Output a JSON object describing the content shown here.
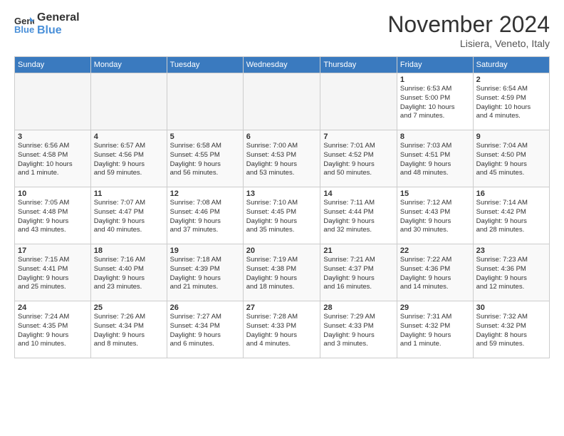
{
  "logo": {
    "line1": "General",
    "line2": "Blue"
  },
  "title": "November 2024",
  "subtitle": "Lisiera, Veneto, Italy",
  "weekdays": [
    "Sunday",
    "Monday",
    "Tuesday",
    "Wednesday",
    "Thursday",
    "Friday",
    "Saturday"
  ],
  "weeks": [
    [
      {
        "day": "",
        "info": ""
      },
      {
        "day": "",
        "info": ""
      },
      {
        "day": "",
        "info": ""
      },
      {
        "day": "",
        "info": ""
      },
      {
        "day": "",
        "info": ""
      },
      {
        "day": "1",
        "info": "Sunrise: 6:53 AM\nSunset: 5:00 PM\nDaylight: 10 hours\nand 7 minutes."
      },
      {
        "day": "2",
        "info": "Sunrise: 6:54 AM\nSunset: 4:59 PM\nDaylight: 10 hours\nand 4 minutes."
      }
    ],
    [
      {
        "day": "3",
        "info": "Sunrise: 6:56 AM\nSunset: 4:58 PM\nDaylight: 10 hours\nand 1 minute."
      },
      {
        "day": "4",
        "info": "Sunrise: 6:57 AM\nSunset: 4:56 PM\nDaylight: 9 hours\nand 59 minutes."
      },
      {
        "day": "5",
        "info": "Sunrise: 6:58 AM\nSunset: 4:55 PM\nDaylight: 9 hours\nand 56 minutes."
      },
      {
        "day": "6",
        "info": "Sunrise: 7:00 AM\nSunset: 4:53 PM\nDaylight: 9 hours\nand 53 minutes."
      },
      {
        "day": "7",
        "info": "Sunrise: 7:01 AM\nSunset: 4:52 PM\nDaylight: 9 hours\nand 50 minutes."
      },
      {
        "day": "8",
        "info": "Sunrise: 7:03 AM\nSunset: 4:51 PM\nDaylight: 9 hours\nand 48 minutes."
      },
      {
        "day": "9",
        "info": "Sunrise: 7:04 AM\nSunset: 4:50 PM\nDaylight: 9 hours\nand 45 minutes."
      }
    ],
    [
      {
        "day": "10",
        "info": "Sunrise: 7:05 AM\nSunset: 4:48 PM\nDaylight: 9 hours\nand 43 minutes."
      },
      {
        "day": "11",
        "info": "Sunrise: 7:07 AM\nSunset: 4:47 PM\nDaylight: 9 hours\nand 40 minutes."
      },
      {
        "day": "12",
        "info": "Sunrise: 7:08 AM\nSunset: 4:46 PM\nDaylight: 9 hours\nand 37 minutes."
      },
      {
        "day": "13",
        "info": "Sunrise: 7:10 AM\nSunset: 4:45 PM\nDaylight: 9 hours\nand 35 minutes."
      },
      {
        "day": "14",
        "info": "Sunrise: 7:11 AM\nSunset: 4:44 PM\nDaylight: 9 hours\nand 32 minutes."
      },
      {
        "day": "15",
        "info": "Sunrise: 7:12 AM\nSunset: 4:43 PM\nDaylight: 9 hours\nand 30 minutes."
      },
      {
        "day": "16",
        "info": "Sunrise: 7:14 AM\nSunset: 4:42 PM\nDaylight: 9 hours\nand 28 minutes."
      }
    ],
    [
      {
        "day": "17",
        "info": "Sunrise: 7:15 AM\nSunset: 4:41 PM\nDaylight: 9 hours\nand 25 minutes."
      },
      {
        "day": "18",
        "info": "Sunrise: 7:16 AM\nSunset: 4:40 PM\nDaylight: 9 hours\nand 23 minutes."
      },
      {
        "day": "19",
        "info": "Sunrise: 7:18 AM\nSunset: 4:39 PM\nDaylight: 9 hours\nand 21 minutes."
      },
      {
        "day": "20",
        "info": "Sunrise: 7:19 AM\nSunset: 4:38 PM\nDaylight: 9 hours\nand 18 minutes."
      },
      {
        "day": "21",
        "info": "Sunrise: 7:21 AM\nSunset: 4:37 PM\nDaylight: 9 hours\nand 16 minutes."
      },
      {
        "day": "22",
        "info": "Sunrise: 7:22 AM\nSunset: 4:36 PM\nDaylight: 9 hours\nand 14 minutes."
      },
      {
        "day": "23",
        "info": "Sunrise: 7:23 AM\nSunset: 4:36 PM\nDaylight: 9 hours\nand 12 minutes."
      }
    ],
    [
      {
        "day": "24",
        "info": "Sunrise: 7:24 AM\nSunset: 4:35 PM\nDaylight: 9 hours\nand 10 minutes."
      },
      {
        "day": "25",
        "info": "Sunrise: 7:26 AM\nSunset: 4:34 PM\nDaylight: 9 hours\nand 8 minutes."
      },
      {
        "day": "26",
        "info": "Sunrise: 7:27 AM\nSunset: 4:34 PM\nDaylight: 9 hours\nand 6 minutes."
      },
      {
        "day": "27",
        "info": "Sunrise: 7:28 AM\nSunset: 4:33 PM\nDaylight: 9 hours\nand 4 minutes."
      },
      {
        "day": "28",
        "info": "Sunrise: 7:29 AM\nSunset: 4:33 PM\nDaylight: 9 hours\nand 3 minutes."
      },
      {
        "day": "29",
        "info": "Sunrise: 7:31 AM\nSunset: 4:32 PM\nDaylight: 9 hours\nand 1 minute."
      },
      {
        "day": "30",
        "info": "Sunrise: 7:32 AM\nSunset: 4:32 PM\nDaylight: 8 hours\nand 59 minutes."
      }
    ]
  ]
}
